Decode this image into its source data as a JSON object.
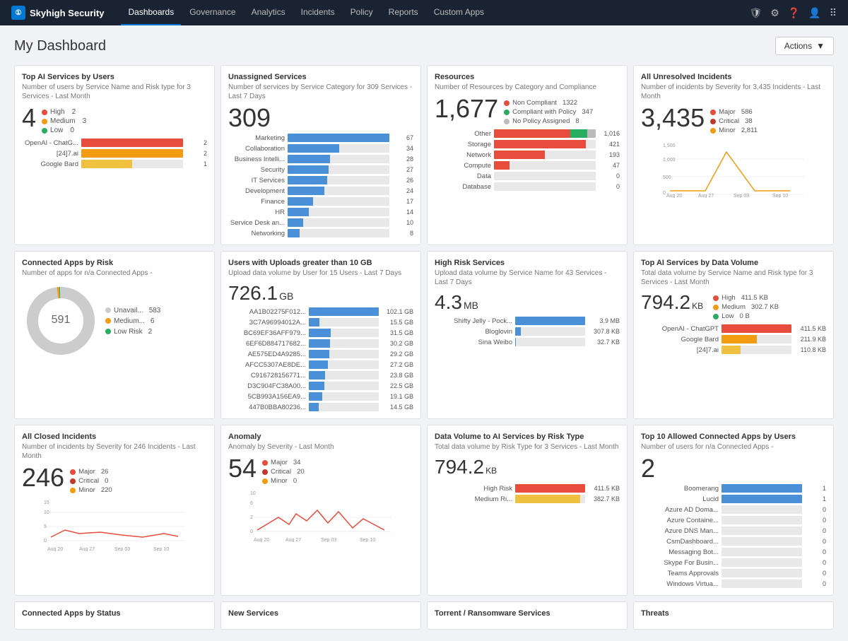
{
  "brand": {
    "name": "Skyhigh Security",
    "icon": "①"
  },
  "nav": {
    "links": [
      {
        "label": "Dashboards",
        "active": true
      },
      {
        "label": "Governance",
        "active": false
      },
      {
        "label": "Analytics",
        "active": false
      },
      {
        "label": "Incidents",
        "active": false
      },
      {
        "label": "Policy",
        "active": false
      },
      {
        "label": "Reports",
        "active": false
      },
      {
        "label": "Custom Apps",
        "active": false
      }
    ]
  },
  "page": {
    "title": "My Dashboard",
    "actions_label": "Actions"
  },
  "cards": {
    "top_ai_services": {
      "title": "Top AI Services by Users",
      "subtitle": "Number of users by Service Name and Risk type for 3 Services - Last Month",
      "big_number": "4",
      "legend": [
        {
          "label": "High",
          "color": "#e74c3c",
          "value": "2"
        },
        {
          "label": "Medium",
          "color": "#f39c12",
          "value": "3"
        },
        {
          "label": "Low",
          "color": "#27ae60",
          "value": "0"
        }
      ],
      "bars": [
        {
          "label": "OpenAI - ChatG...",
          "value": 2,
          "pct": 100,
          "color": "#e74c3c"
        },
        {
          "label": "[24]7.ai",
          "value": 2,
          "pct": 100,
          "color": "#f39c12"
        },
        {
          "label": "Google Bard",
          "value": 1,
          "pct": 50,
          "color": "#f0c040"
        }
      ]
    },
    "unassigned_services": {
      "title": "Unassigned Services",
      "subtitle": "Number of services by Service Category for 309 Services - Last 7 Days",
      "big_number": "309",
      "bars": [
        {
          "label": "Marketing",
          "value": 67,
          "pct": 100,
          "color": "#4a90d9"
        },
        {
          "label": "Collaboration",
          "value": 34,
          "pct": 51,
          "color": "#4a90d9"
        },
        {
          "label": "Business Intelli...",
          "value": 28,
          "pct": 42,
          "color": "#4a90d9"
        },
        {
          "label": "Security",
          "value": 27,
          "pct": 40,
          "color": "#4a90d9"
        },
        {
          "label": "IT Services",
          "value": 26,
          "pct": 39,
          "color": "#4a90d9"
        },
        {
          "label": "Development",
          "value": 24,
          "pct": 36,
          "color": "#4a90d9"
        },
        {
          "label": "Finance",
          "value": 17,
          "pct": 25,
          "color": "#4a90d9"
        },
        {
          "label": "HR",
          "value": 14,
          "pct": 21,
          "color": "#4a90d9"
        },
        {
          "label": "Service Desk an...",
          "value": 10,
          "pct": 15,
          "color": "#4a90d9"
        },
        {
          "label": "Networking",
          "value": 8,
          "pct": 12,
          "color": "#4a90d9"
        }
      ]
    },
    "resources": {
      "title": "Resources",
      "subtitle": "Number of Resources by Category and Compliance",
      "big_number": "1,677",
      "legend": [
        {
          "label": "Non Compliant",
          "color": "#e74c3c",
          "value": "1322"
        },
        {
          "label": "Compliant with Policy",
          "color": "#27ae60",
          "value": "347"
        },
        {
          "label": "No Policy Assigned",
          "color": "#bbb",
          "value": "8"
        }
      ],
      "bars": [
        {
          "label": "Other",
          "value": 1016,
          "pct": 100,
          "red": 75,
          "green": 17,
          "gray": 8,
          "color_r": "#e74c3c",
          "color_g": "#27ae60"
        },
        {
          "label": "Storage",
          "value": 421,
          "pct": 41,
          "red": 90,
          "green": 10,
          "color": "#e74c3c"
        },
        {
          "label": "Network",
          "value": 193,
          "pct": 19,
          "red": 95,
          "green": 5,
          "color": "#e74c3c"
        },
        {
          "label": "Compute",
          "value": 47,
          "pct": 5,
          "red": 85,
          "green": 15,
          "color": "#e74c3c"
        },
        {
          "label": "Data",
          "value": 0,
          "pct": 0,
          "color": "#4a90d9"
        },
        {
          "label": "Database",
          "value": 0,
          "pct": 0,
          "color": "#4a90d9"
        }
      ]
    },
    "all_unresolved": {
      "title": "All Unresolved Incidents",
      "subtitle": "Number of incidents by Severity for 3,435 Incidents - Last Month",
      "big_number": "3,435",
      "legend": [
        {
          "label": "Major",
          "color": "#e74c3c",
          "value": "586"
        },
        {
          "label": "Critical",
          "color": "#e74c3c",
          "value": "38"
        },
        {
          "label": "Minor",
          "color": "#f39c12",
          "value": "2,811"
        }
      ],
      "chart_type": "line",
      "x_labels": [
        "Aug 20",
        "Aug 27",
        "Sep 03",
        "Sep 10"
      ]
    },
    "connected_apps_risk": {
      "title": "Connected Apps by Risk",
      "subtitle": "Number of apps for n/a Connected Apps -",
      "big_number": "591",
      "donut": {
        "segments": [
          {
            "label": "Unavail...",
            "value": 583,
            "pct": 98.5,
            "color": "#ccc"
          },
          {
            "label": "Medium...",
            "value": 6,
            "pct": 1.0,
            "color": "#f39c12"
          },
          {
            "label": "Low Risk",
            "value": 2,
            "pct": 0.5,
            "color": "#27ae60"
          }
        ]
      }
    },
    "users_uploads": {
      "title": "Users with Uploads greater than 10 GB",
      "subtitle": "Upload data volume by User for 15 Users - Last 7 Days",
      "big_number": "726.1",
      "big_unit": "GB",
      "bars": [
        {
          "label": "AA1B02275F012...",
          "value": "102.1 GB",
          "pct": 100,
          "color": "#4a90d9"
        },
        {
          "label": "3C7A96994012A...",
          "value": "15.5 GB",
          "pct": 15,
          "color": "#4a90d9"
        },
        {
          "label": "BC69EF36AFF979...",
          "value": "31.5 GB",
          "pct": 31,
          "color": "#4a90d9"
        },
        {
          "label": "6EF6D884717682...",
          "value": "30.2 GB",
          "pct": 30,
          "color": "#4a90d9"
        },
        {
          "label": "AE575ED4A9285...",
          "value": "29.2 GB",
          "pct": 29,
          "color": "#4a90d9"
        },
        {
          "label": "AFCC5307AE8DE...",
          "value": "27.2 GB",
          "pct": 27,
          "color": "#4a90d9"
        },
        {
          "label": "C916728156771...",
          "value": "23.8 GB",
          "pct": 23,
          "color": "#4a90d9"
        },
        {
          "label": "D3C904FC38A00...",
          "value": "22.5 GB",
          "pct": 22,
          "color": "#4a90d9"
        },
        {
          "label": "5CB993A156EA9...",
          "value": "19.1 GB",
          "pct": 19,
          "color": "#4a90d9"
        },
        {
          "label": "447B0BBA80236...",
          "value": "14.5 GB",
          "pct": 14,
          "color": "#4a90d9"
        }
      ]
    },
    "high_risk_services": {
      "title": "High Risk Services",
      "subtitle": "Upload data volume by Service Name for 43 Services - Last 7 Days",
      "big_number": "4.3",
      "big_unit": "MB",
      "bars": [
        {
          "label": "Shifty Jelly - Pock...",
          "value": "3.9 MB",
          "pct": 100,
          "color": "#4a90d9"
        },
        {
          "label": "Bloglovin",
          "value": "307.8 KB",
          "pct": 8,
          "color": "#4a90d9"
        },
        {
          "label": "Sina Weibo",
          "value": "32.7 KB",
          "pct": 1,
          "color": "#4a90d9"
        }
      ]
    },
    "top_ai_data_volume": {
      "title": "Top AI Services by Data Volume",
      "subtitle": "Total data volume by Service Name and Risk type for 3 Services - Last Month",
      "big_number": "794.2",
      "big_unit": "KB",
      "legend": [
        {
          "label": "High",
          "color": "#e74c3c",
          "value": "411.5 KB"
        },
        {
          "label": "Medium",
          "color": "#f39c12",
          "value": "302.7 KB"
        },
        {
          "label": "Low",
          "color": "#27ae60",
          "value": "0 B"
        }
      ],
      "bars": [
        {
          "label": "OpenAI - ChatGPT",
          "value": "411.5 KB",
          "pct": 100,
          "color": "#e74c3c"
        },
        {
          "label": "Google Bard",
          "value": "211.9 KB",
          "pct": 51,
          "color": "#f39c12"
        },
        {
          "label": "[24]7.ai",
          "value": "110.8 KB",
          "pct": 27,
          "color": "#f0c040"
        }
      ]
    },
    "all_closed": {
      "title": "All Closed Incidents",
      "subtitle": "Number of incidents by Severity for 246 Incidents - Last Month",
      "big_number": "246",
      "legend": [
        {
          "label": "Major",
          "color": "#e74c3c",
          "value": "26"
        },
        {
          "label": "Critical",
          "color": "#c0392b",
          "value": "0"
        },
        {
          "label": "Minor",
          "color": "#f39c12",
          "value": "220"
        }
      ],
      "chart_type": "line",
      "x_labels": [
        "Aug 20",
        "Aug 27",
        "Sep 03",
        "Sep 10"
      ]
    },
    "anomaly": {
      "title": "Anomaly",
      "subtitle": "Anomaly by Severity - Last Month",
      "big_number": "54",
      "legend": [
        {
          "label": "Major",
          "color": "#e74c3c",
          "value": "34"
        },
        {
          "label": "Critical",
          "color": "#c0392b",
          "value": "20"
        },
        {
          "label": "Minor",
          "color": "#f39c12",
          "value": "0"
        }
      ],
      "chart_type": "line",
      "x_labels": [
        "Aug 20",
        "Aug 27",
        "Sep 03",
        "Sep 10"
      ]
    },
    "data_volume_ai": {
      "title": "Data Volume to AI Services by Risk Type",
      "subtitle": "Total data volume by Risk Type for 3 Services - Last Month",
      "big_number": "794.2",
      "big_unit": "KB",
      "bars": [
        {
          "label": "High Risk",
          "value": "411.5 KB",
          "pct": 100,
          "color": "#e74c3c"
        },
        {
          "label": "Medium Ri...",
          "value": "382.7 KB",
          "pct": 93,
          "color": "#f0c040"
        }
      ]
    },
    "top_allowed_apps": {
      "title": "Top 10 Allowed Connected Apps by Users",
      "subtitle": "Number of users for n/a Connected Apps -",
      "big_number": "2",
      "bars": [
        {
          "label": "Boomerang",
          "value": "1",
          "pct": 100,
          "color": "#4a90d9"
        },
        {
          "label": "Lucid",
          "value": "1",
          "pct": 100,
          "color": "#4a90d9"
        },
        {
          "label": "Azure AD Doma...",
          "value": "0",
          "pct": 0,
          "color": "#4a90d9"
        },
        {
          "label": "Azure Containe...",
          "value": "0",
          "pct": 0,
          "color": "#4a90d9"
        },
        {
          "label": "Azure DNS Man...",
          "value": "0",
          "pct": 0,
          "color": "#4a90d9"
        },
        {
          "label": "CsmDashboard...",
          "value": "0",
          "pct": 0,
          "color": "#4a90d9"
        },
        {
          "label": "Messaging Bot...",
          "value": "0",
          "pct": 0,
          "color": "#4a90d9"
        },
        {
          "label": "Skype For Busin...",
          "value": "0",
          "pct": 0,
          "color": "#4a90d9"
        },
        {
          "label": "Teams Approvals",
          "value": "0",
          "pct": 0,
          "color": "#4a90d9"
        },
        {
          "label": "Windows Virtua...",
          "value": "0",
          "pct": 0,
          "color": "#4a90d9"
        }
      ]
    },
    "bottom_row": [
      {
        "title": "Connected Apps by Status",
        "subtitle": ""
      },
      {
        "title": "New Services",
        "subtitle": ""
      },
      {
        "title": "Torrent / Ransomware Services",
        "subtitle": ""
      },
      {
        "title": "Threats",
        "subtitle": ""
      }
    ]
  }
}
